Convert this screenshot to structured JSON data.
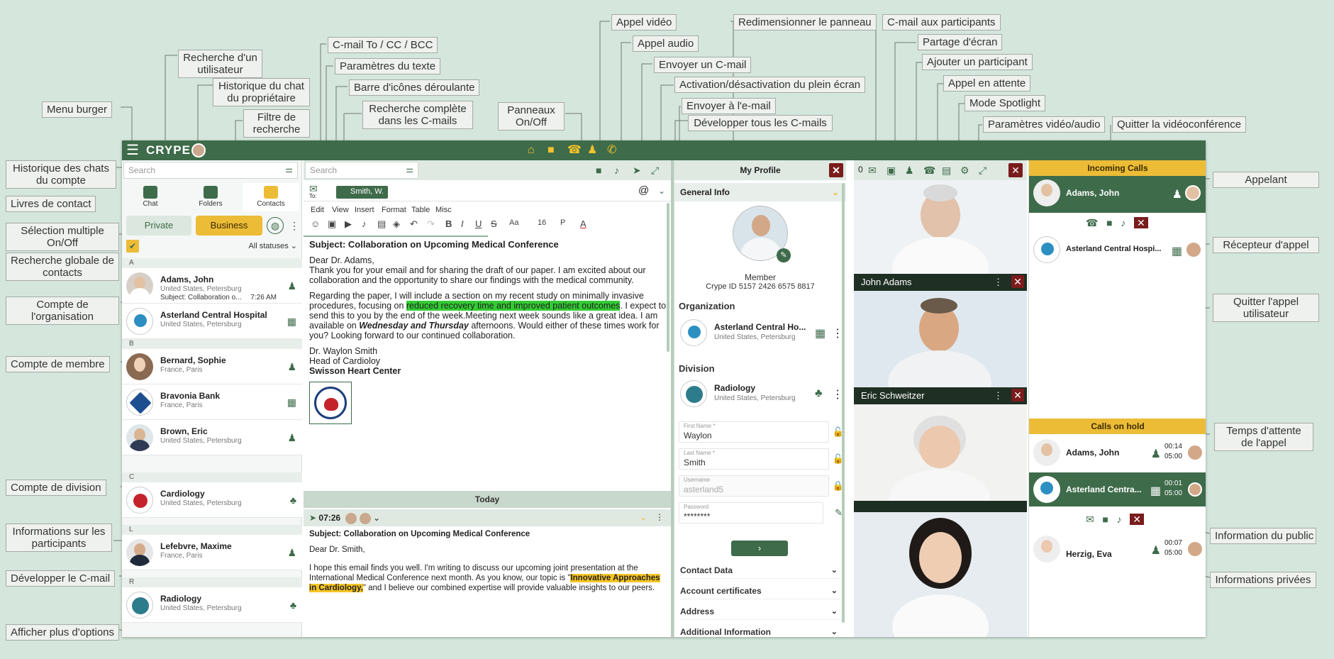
{
  "app": {
    "logo": "CRYPE"
  },
  "colors": {
    "brand_green": "#3e6b4a",
    "accent_yellow": "#ecbc37",
    "close_red": "#7a1c1c"
  },
  "left": {
    "search_placeholder": "Search",
    "tabs": [
      {
        "label": "Chat"
      },
      {
        "label": "Folders"
      },
      {
        "label": "Contacts"
      }
    ],
    "filters": {
      "private": "Private",
      "business": "Business",
      "statuses": "All statuses"
    },
    "sections": [
      "A",
      "B",
      "C",
      "L",
      "R"
    ],
    "contacts": [
      {
        "name": "Adams, John",
        "location": "United States, Petersburg",
        "subject": "Subject: Collaboration o...",
        "time": "7:26 AM",
        "type": "member"
      },
      {
        "name": "Asterland Central Hospital",
        "location": "United States, Petersburg",
        "type": "organization"
      },
      {
        "name": "Bernard, Sophie",
        "location": "France, Paris",
        "type": "member"
      },
      {
        "name": "Bravonia Bank",
        "location": "France, Paris",
        "type": "organization"
      },
      {
        "name": "Brown, Eric",
        "location": "United States, Petersburg",
        "type": "member"
      },
      {
        "name": "Cardiology",
        "location": "United States, Petersburg",
        "type": "division"
      },
      {
        "name": "Lefebvre, Maxime",
        "location": "France, Paris",
        "type": "member"
      },
      {
        "name": "Radiology",
        "location": "United States, Petersburg",
        "type": "division"
      }
    ]
  },
  "mid": {
    "search_placeholder": "Search",
    "to_label": "To:",
    "recipient": "Smith, W.",
    "menus": [
      "Edit",
      "View",
      "Insert",
      "Format",
      "Table",
      "Misc"
    ],
    "font_size": "16",
    "paragraph": "P",
    "aa": "Aa",
    "email": {
      "subject": "Subject: Collaboration on Upcoming Medical Conference",
      "greeting": "Dear Dr. Adams,",
      "p1": "Thank you for your email and for sharing the draft of our paper. I am excited about our collaboration and the opportunity to share our findings with the medical community.",
      "p2_a": "Regarding the paper, I will include a section on my recent study on minimally invasive procedures, focusing on ",
      "p2_hl": "reduced recovery time and improved patient outcomes",
      "p2_b": ". I expect to send this to you by the end of the week.Meeting next week sounds like a great idea. I am available on ",
      "p2_bold": "Wednesday and Thursday",
      "p2_c": " afternoons. Would either of these times work for you? Looking forward to our continued collaboration.",
      "sig1": "Dr. Waylon Smith",
      "sig2": "Head of Cardioloy",
      "sig3": "Swisson Heart Center"
    },
    "today": "Today",
    "reply": {
      "time": "07:26",
      "subject": "Subject: Collaboration on Upcoming Medical Conference",
      "greeting": "Dear Dr. Smith,",
      "p1_a": "I hope this email finds you well. I'm writing to discuss our upcoming joint presentation at the International Medical Conference next month. As you know, our topic is \"",
      "p1_hl": "Innovative Approaches in Cardiology,",
      "p1_b": "\" and I believe our combined expertise will provide valuable insights to our peers."
    }
  },
  "profile": {
    "title": "My Profile",
    "general": "General Info",
    "role": "Member",
    "crype_id": "Crype ID 5157 2426 6575 8817",
    "organization_label": "Organization",
    "org_name": "Asterland Central Ho...",
    "org_loc": "United States, Petersburg",
    "division_label": "Division",
    "div_name": "Radiology",
    "div_loc": "United States, Petersburg",
    "first_name_label": "First Name *",
    "first_name": "Waylon",
    "last_name_label": "Last Name *",
    "last_name": "Smith",
    "username_label": "Username",
    "username": "asterland5",
    "password_label": "Password",
    "password": "********",
    "sections": [
      "Contact Data",
      "Account certificates",
      "Address",
      "Additional Information"
    ]
  },
  "video": {
    "count": "0",
    "participants": [
      "John Adams",
      "Eric Schweitzer"
    ]
  },
  "calls": {
    "incoming_title": "Incoming Calls",
    "incoming_caller": "Adams, John",
    "incoming_receiver": "Asterland Central Hospi...",
    "hold_title": "Calls on hold",
    "hold": [
      {
        "name": "Adams, John",
        "t1": "00:14",
        "t2": "05:00"
      },
      {
        "name": "Asterland Centra...",
        "t1": "00:01",
        "t2": "05:00"
      },
      {
        "name": "Herzig, Eva",
        "t1": "00:07",
        "t2": "05:00"
      }
    ]
  },
  "annotations": [
    "Menu burger",
    "Recherche d'un utilisateur",
    "Historique du chat du propriétaire",
    "Filtre de recherche",
    "C-mail To / CC / BCC",
    "Paramètres du texte",
    "Barre d'icônes déroulante",
    "Recherche complète dans les C-mails",
    "Panneaux On/Off",
    "Appel vidéo",
    "Appel audio",
    "Envoyer un C-mail",
    "Activation/désactivation du plein écran",
    "Envoyer à l'e-mail",
    "Développer tous les C-mails",
    "Redimensionner le panneau",
    "C-mail aux participants",
    "Partage d'écran",
    "Ajouter un participant",
    "Appel en attente",
    "Mode Spotlight",
    "Paramètres vidéo/audio",
    "Quitter la vidéoconférence",
    "Historique des chats du compte",
    "Livres de contact",
    "Sélection multiple On/Off",
    "Recherche globale de contacts",
    "Compte de l'organisation",
    "Compte de membre",
    "Compte de division",
    "Informations sur les participants",
    "Développer le C-mail",
    "Afficher plus d'options",
    "Appelant",
    "Récepteur d'appel",
    "Quitter l'appel utilisateur",
    "Temps d'attente de l'appel",
    "Information du public",
    "Informations privées"
  ]
}
